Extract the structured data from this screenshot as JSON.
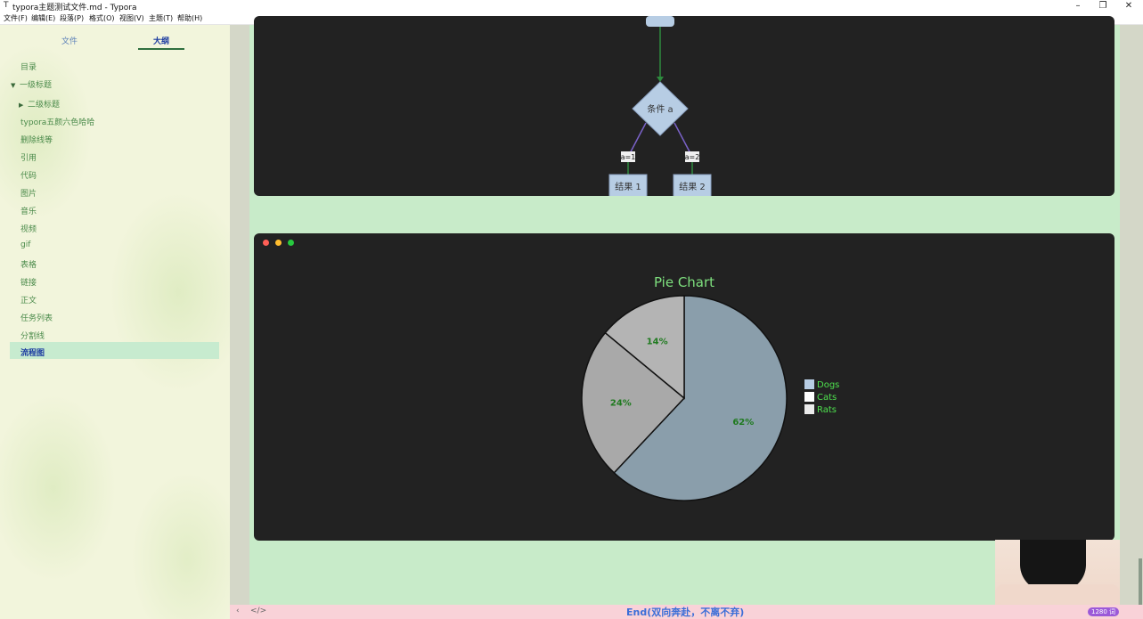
{
  "window": {
    "title": "typora主题测试文件.md - Typora",
    "app_icon": "T",
    "controls": {
      "minimize": "–",
      "restore": "❐",
      "close": "✕"
    }
  },
  "menu": [
    "文件(F)",
    "编辑(E)",
    "段落(P)",
    "格式(O)",
    "视图(V)",
    "主题(T)",
    "帮助(H)"
  ],
  "sidebar": {
    "tabs": {
      "files": "文件",
      "outline": "大纲"
    },
    "items": [
      {
        "label": "目录"
      },
      {
        "label": "一级标题",
        "arrow": "▼"
      },
      {
        "label": "二级标题",
        "arrow": "▶"
      },
      {
        "label": "typora五颜六色哈哈"
      },
      {
        "label": "删除线等"
      },
      {
        "label": "引用"
      },
      {
        "label": "代码"
      },
      {
        "label": "图片"
      },
      {
        "label": "音乐"
      },
      {
        "label": "视频"
      },
      {
        "label": "gif"
      },
      {
        "label": "表格"
      },
      {
        "label": "链接"
      },
      {
        "label": "正文"
      },
      {
        "label": "任务列表"
      },
      {
        "label": "分割线"
      },
      {
        "label": "流程图",
        "active": true
      }
    ]
  },
  "flowchart": {
    "condition": "条件 a",
    "branch_left": "a=1",
    "branch_right": "a=2",
    "result_left": "结果 1",
    "result_right": "结果 2"
  },
  "window_dots": [
    "#ff5f56",
    "#ffbd2e",
    "#27c93f"
  ],
  "chart_data": {
    "type": "pie",
    "title": "Pie Chart",
    "categories": [
      "Dogs",
      "Cats",
      "Rats"
    ],
    "values": [
      62,
      24,
      14
    ],
    "labels": [
      "62%",
      "24%",
      "14%"
    ],
    "colors": [
      "#8a9eab",
      "#a9a9a9",
      "#b4b4b4"
    ],
    "legend_colors": [
      "#b7cde4",
      "#ffffff",
      "#ebebeb"
    ],
    "legend": "right"
  },
  "status": {
    "end_text": "End(双向奔赴，不离不弃)",
    "word_count": "1280 词",
    "left_icon": "‹",
    "code_icon": "</>"
  }
}
